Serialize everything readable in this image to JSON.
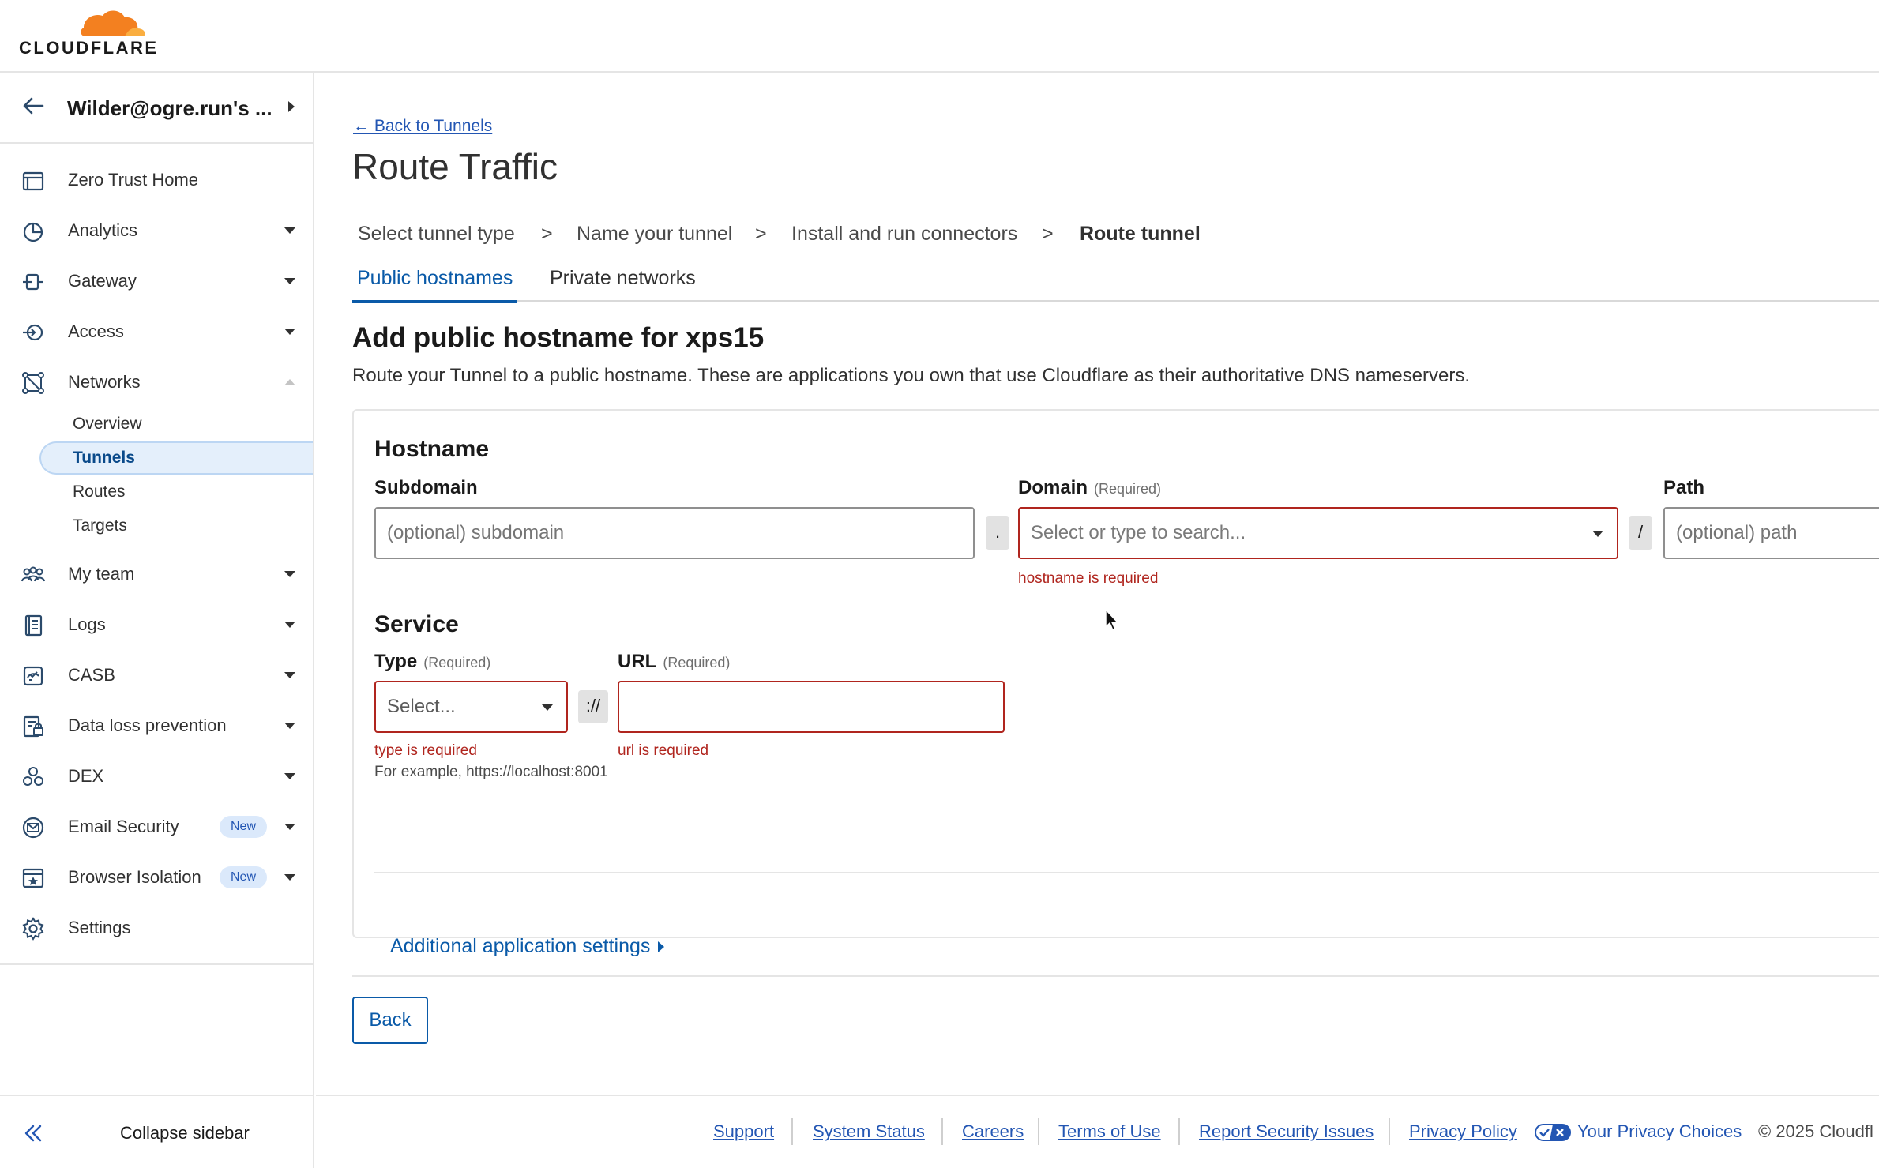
{
  "brand": {
    "wordmark": "CLOUDFLARE",
    "logo_colors": [
      "#f38020",
      "#faae40"
    ]
  },
  "account": {
    "name": "Wilder@ogre.run's ..."
  },
  "sidebar": {
    "items": [
      {
        "label": "Zero Trust Home",
        "icon": "home-panel-icon"
      },
      {
        "label": "Analytics",
        "icon": "analytics-pie-icon",
        "expandable": true
      },
      {
        "label": "Gateway",
        "icon": "gateway-icon",
        "expandable": true
      },
      {
        "label": "Access",
        "icon": "access-icon",
        "expandable": true
      },
      {
        "label": "Networks",
        "icon": "networks-icon",
        "expanded": true
      },
      {
        "label": "My team",
        "icon": "team-icon",
        "expandable": true
      },
      {
        "label": "Logs",
        "icon": "logs-icon",
        "expandable": true
      },
      {
        "label": "CASB",
        "icon": "casb-icon",
        "expandable": true
      },
      {
        "label": "Data loss prevention",
        "icon": "dlp-icon",
        "expandable": true
      },
      {
        "label": "DEX",
        "icon": "dex-icon",
        "expandable": true
      },
      {
        "label": "Email Security",
        "icon": "email-security-icon",
        "expandable": true,
        "badge": "New"
      },
      {
        "label": "Browser Isolation",
        "icon": "browser-isolation-icon",
        "expandable": true,
        "badge": "New"
      },
      {
        "label": "Settings",
        "icon": "gear-icon"
      }
    ],
    "networks_sub": [
      "Overview",
      "Tunnels",
      "Routes",
      "Targets"
    ],
    "active_sub": "Tunnels",
    "collapse_label": "Collapse sidebar"
  },
  "main": {
    "back_link": "← Back to Tunnels",
    "title": "Route Traffic",
    "steps": [
      "Select tunnel type",
      ">",
      "Name your tunnel",
      ">",
      "Install and run connectors",
      ">",
      "Route tunnel"
    ],
    "tabs": [
      "Public hostnames",
      "Private networks"
    ],
    "active_tab": "Public hostnames",
    "section_title": "Add public hostname for xps15",
    "section_desc": "Route your Tunnel to a public hostname. These are applications you own that use Cloudflare as their authoritative DNS nameservers.",
    "hostname": {
      "heading": "Hostname",
      "subdomain_label": "Subdomain",
      "subdomain_placeholder": "(optional) subdomain",
      "dot": ".",
      "domain_label": "Domain",
      "domain_req": "(Required)",
      "domain_placeholder": "Select or type to search...",
      "domain_error": "hostname is required",
      "slash": "/",
      "path_label": "Path",
      "path_placeholder": "(optional) path"
    },
    "service": {
      "heading": "Service",
      "type_label": "Type",
      "type_req": "(Required)",
      "type_placeholder": "Select...",
      "scheme_sep": "://",
      "url_label": "URL",
      "url_req": "(Required)",
      "url_value": "",
      "type_error": "type is required",
      "url_error": "url is required",
      "hint": "For example, https://localhost:8001"
    },
    "additional_settings": "Additional application settings",
    "back_button": "Back"
  },
  "footer": {
    "links": [
      "Support",
      "System Status",
      "Careers",
      "Terms of Use",
      "Report Security Issues",
      "Privacy Policy"
    ],
    "privacy_choices": "Your Privacy Choices",
    "copyright": "© 2025 Cloudfl"
  },
  "colors": {
    "accent": "#0a5aa8",
    "link": "#2356b3",
    "error": "#b0251e",
    "badge_bg": "#dbe9fb"
  }
}
